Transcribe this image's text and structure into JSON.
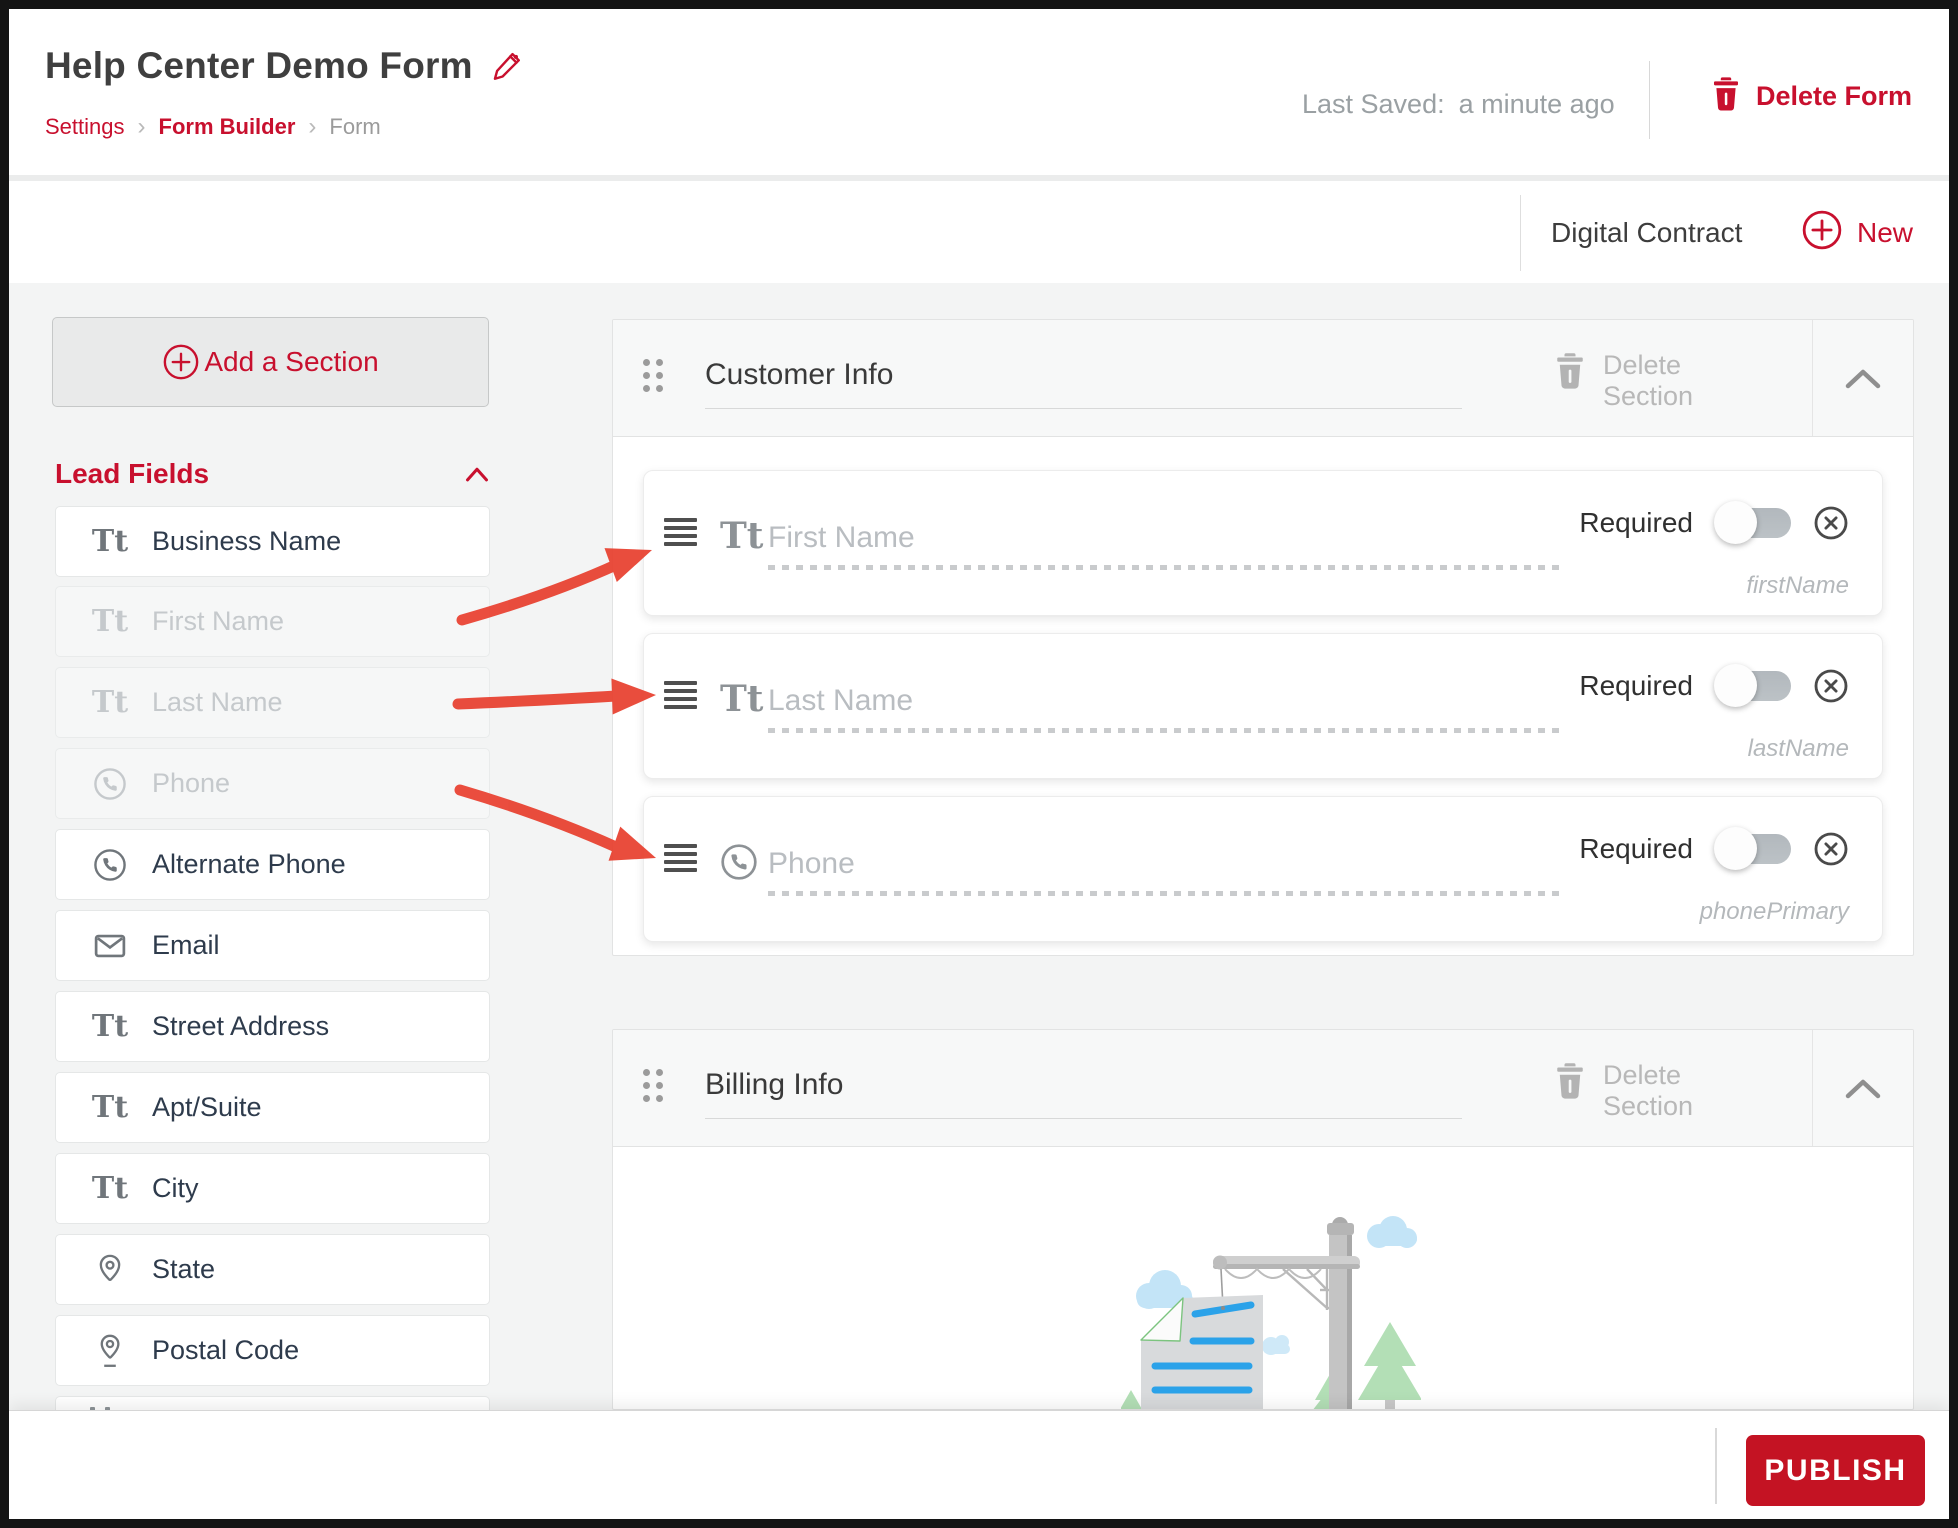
{
  "header": {
    "title": "Help Center Demo Form",
    "breadcrumb": [
      "Settings",
      "Form Builder",
      "Form"
    ],
    "last_saved_label": "Last Saved:",
    "last_saved_value": "a minute ago",
    "delete_form_label": "Delete Form"
  },
  "toolbar": {
    "contract_label": "Digital Contract",
    "new_label": "New"
  },
  "sidebar": {
    "add_section_label": "Add a Section",
    "group_label": "Lead Fields",
    "items": [
      {
        "label": "Business Name",
        "icon": "text-icon",
        "disabled": false
      },
      {
        "label": "First Name",
        "icon": "text-icon",
        "disabled": true
      },
      {
        "label": "Last Name",
        "icon": "text-icon",
        "disabled": true
      },
      {
        "label": "Phone",
        "icon": "phone-icon",
        "disabled": true
      },
      {
        "label": "Alternate Phone",
        "icon": "phone-icon",
        "disabled": false
      },
      {
        "label": "Email",
        "icon": "email-icon",
        "disabled": false
      },
      {
        "label": "Street Address",
        "icon": "text-icon",
        "disabled": false
      },
      {
        "label": "Apt/Suite",
        "icon": "text-icon",
        "disabled": false
      },
      {
        "label": "City",
        "icon": "text-icon",
        "disabled": false
      },
      {
        "label": "State",
        "icon": "map-pin-icon",
        "disabled": false
      },
      {
        "label": "Postal Code",
        "icon": "map-pin-underline-icon",
        "disabled": false
      }
    ]
  },
  "sections": [
    {
      "title": "Customer Info",
      "delete_line1": "Delete",
      "delete_line2": "Section",
      "fields": [
        {
          "placeholder": "First Name",
          "icon": "text-icon",
          "required_label": "Required",
          "key": "firstName",
          "toggle_state": "off"
        },
        {
          "placeholder": "Last Name",
          "icon": "text-icon",
          "required_label": "Required",
          "key": "lastName",
          "toggle_state": "off"
        },
        {
          "placeholder": "Phone",
          "icon": "phone-icon",
          "required_label": "Required",
          "key": "phonePrimary",
          "toggle_state": "off"
        }
      ]
    },
    {
      "title": "Billing Info",
      "delete_line1": "Delete",
      "delete_line2": "Section"
    }
  ],
  "footer": {
    "publish_label": "PUBLISH"
  },
  "colors": {
    "accent_red": "#c8102e",
    "publish_red": "#c41323",
    "arrow_red": "#e8402f",
    "navy_text": "#2e3b4c",
    "dark_text": "#3d3d3d",
    "muted_gray": "#b8b8b8",
    "page_bg": "#f3f4f4",
    "illustration_blue": "#2ba2e9",
    "illustration_green": "#b3dfb6",
    "illustration_cloud": "#c3e4f7"
  }
}
